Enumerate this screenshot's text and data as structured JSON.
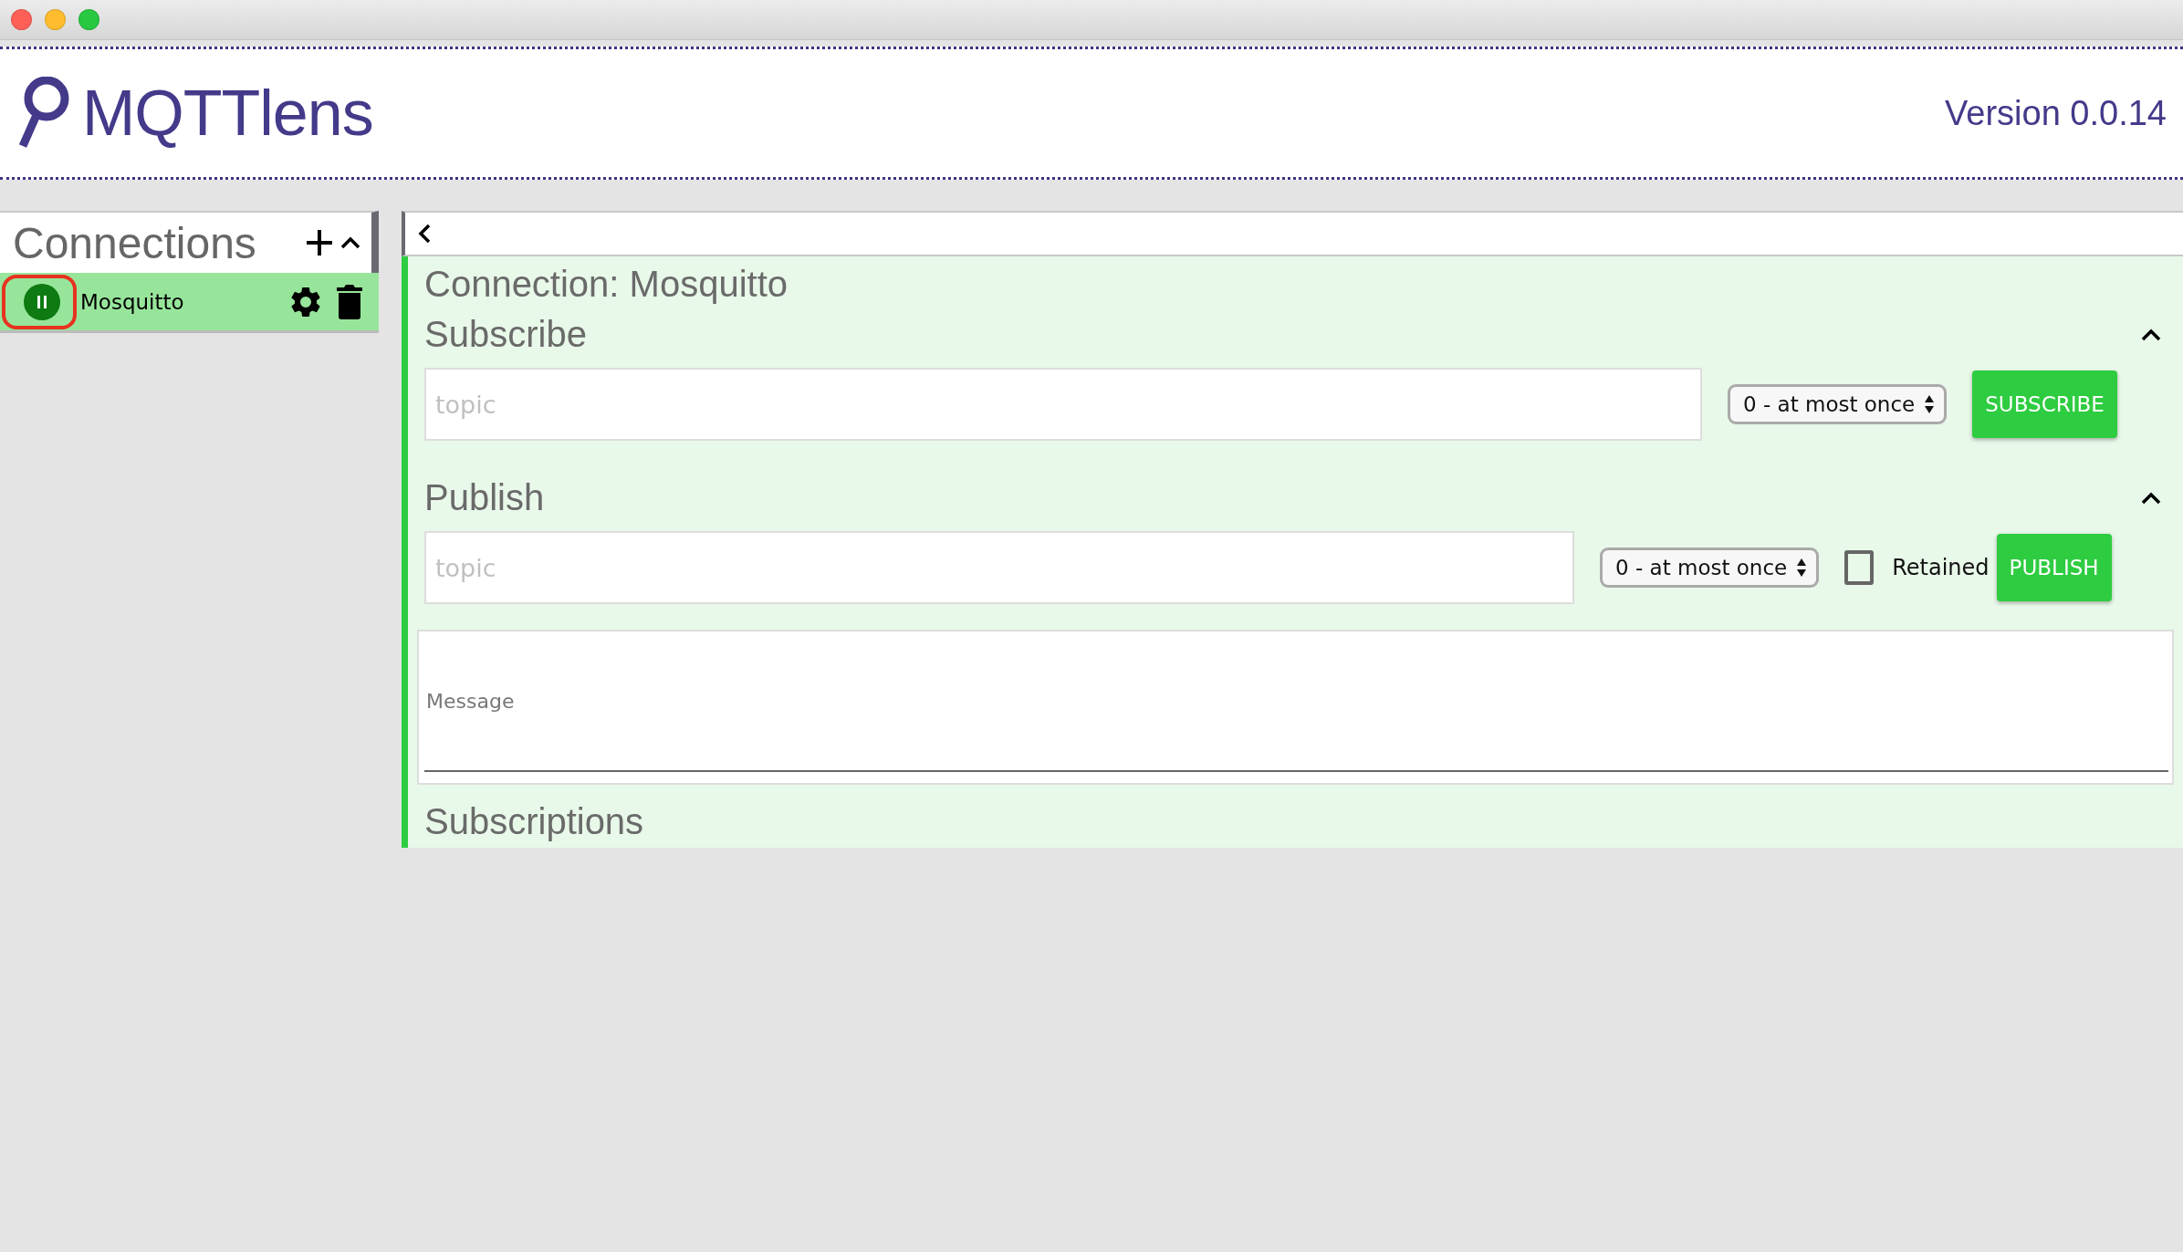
{
  "header": {
    "app_name": "MQTTlens",
    "version": "Version 0.0.14"
  },
  "sidebar": {
    "title": "Connections",
    "expanded": true,
    "connections": [
      {
        "name": "Mosquitto",
        "selected": true,
        "connected": true
      }
    ]
  },
  "main": {
    "connection_title": "Connection: Mosquitto",
    "subscribe": {
      "title": "Subscribe",
      "expanded": true,
      "topic": {
        "placeholder": "topic"
      },
      "qos": "0 - at most once",
      "button": "SUBSCRIBE"
    },
    "publish": {
      "title": "Publish",
      "expanded": true,
      "topic": {
        "placeholder": "topic"
      },
      "qos": "0 - at most once",
      "retained": {
        "label": "Retained",
        "checked": false
      },
      "button": "PUBLISH",
      "message": {
        "placeholder": "Message"
      }
    },
    "subscriptions": {
      "title": "Subscriptions"
    }
  }
}
